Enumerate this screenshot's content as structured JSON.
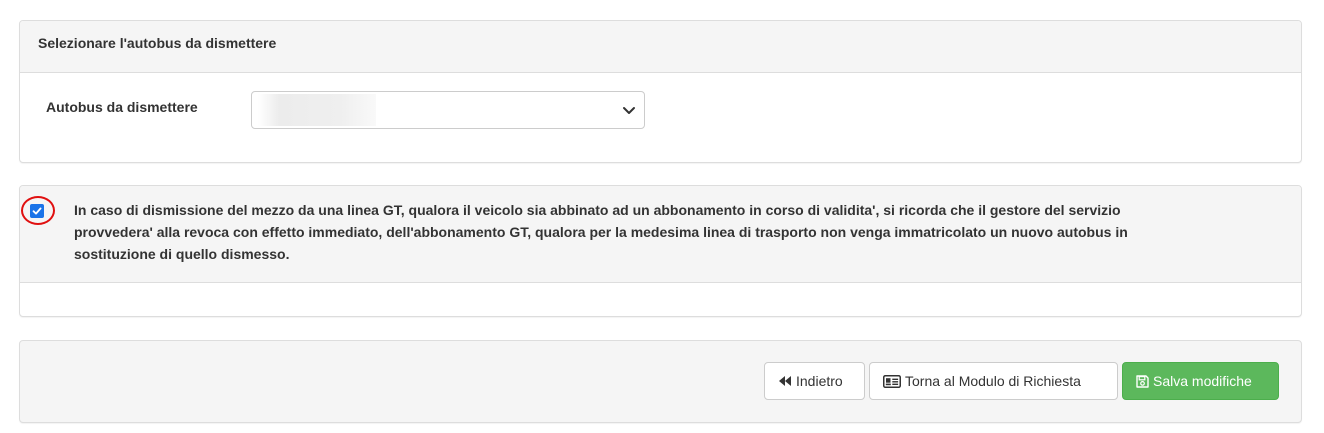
{
  "select_panel": {
    "heading": "Selezionare l'autobus da dismettere",
    "field_label": "Autobus da dismettere",
    "selected_value": ""
  },
  "notice_panel": {
    "checked": true,
    "text": "In caso di dismissione del mezzo da una linea GT, qualora il veicolo sia abbinato ad un abbonamento in corso di validita', si ricorda che il gestore del servizio provvedera' alla revoca con effetto immediato, dell'abbonamento GT, qualora per la medesima linea di trasporto non venga immatricolato un nuovo autobus in sostituzione di quello dismesso."
  },
  "actions": {
    "back_label": "Indietro",
    "back_icon": "backward-icon",
    "form_label": "Torna al Modulo di Richiesta",
    "form_icon": "id-card-icon",
    "save_label": "Salva modifiche",
    "save_icon": "floppy-disk-icon"
  },
  "colors": {
    "save_button": "#5cb85c",
    "highlight_ring": "#e01010",
    "checkbox": "#1a73e8",
    "panel_bg": "#f5f5f5"
  }
}
